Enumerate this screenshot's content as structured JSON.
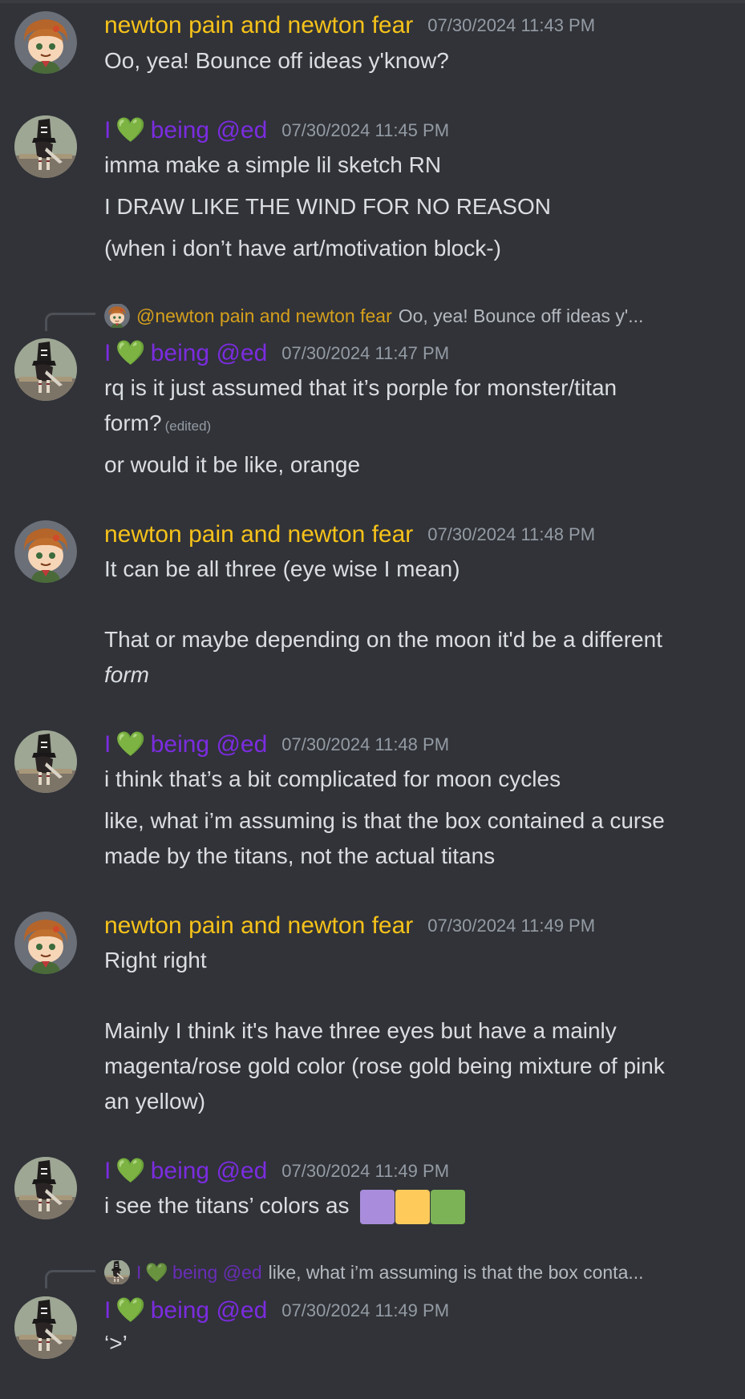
{
  "colors": {
    "newton_name": "#f6c21a",
    "ed_name": "#7b2ce0",
    "swatches": [
      "#a98ddc",
      "#fecb5b",
      "#7cb356"
    ]
  },
  "users": {
    "newton": {
      "name": "newton pain and newton fear",
      "avatar": "chibi-character-avatar"
    },
    "ed": {
      "name_prefix": "I",
      "name_emoji": "💚",
      "name_suffix": "being @ed",
      "avatar": "plague-doctor-avatar"
    }
  },
  "messages": [
    {
      "user": "newton",
      "timestamp": "07/30/2024 11:43 PM",
      "lines": [
        "Oo, yea! Bounce off ideas y'know?"
      ]
    },
    {
      "user": "ed",
      "timestamp": "07/30/2024 11:45 PM",
      "lines": [
        "imma make a simple lil sketch RN",
        "I DRAW LIKE THE WIND FOR NO REASON",
        "(when i don’t have art/motivation block-)"
      ]
    },
    {
      "user": "ed",
      "timestamp": "07/30/2024 11:47 PM",
      "reply": {
        "name": "@newton pain and newton fear",
        "text": "Oo, yea! Bounce off ideas y'..."
      },
      "lines": [
        "rq is it just assumed that it’s porple for monster/titan",
        "form?",
        "or would it be like, orange"
      ],
      "edited": "(edited)"
    },
    {
      "user": "newton",
      "timestamp": "07/30/2024 11:48 PM",
      "lines": [
        "It can be all three (eye wise I mean)",
        "That or maybe depending on the moon it'd be a different",
        "form"
      ]
    },
    {
      "user": "ed",
      "timestamp": "07/30/2024 11:48 PM",
      "lines": [
        "i think that’s a bit complicated for moon cycles",
        "like, what i’m assuming is that the box contained a curse",
        "made by the titans, not the actual titans"
      ]
    },
    {
      "user": "newton",
      "timestamp": "07/30/2024 11:49 PM",
      "lines": [
        "Right right",
        "Mainly I think it's have three eyes but have a mainly",
        "magenta/rose gold color (rose gold being mixture of pink",
        "an yellow)"
      ]
    },
    {
      "user": "ed",
      "timestamp": "07/30/2024 11:49 PM",
      "lines": [
        "i see the titans’ colors as"
      ]
    },
    {
      "user": "ed",
      "timestamp": "07/30/2024 11:49 PM",
      "reply": {
        "name_prefix": "I",
        "name_emoji": "💚",
        "name_suffix": "being @ed",
        "text": "like, what i’m assuming is that the box conta..."
      },
      "lines": [
        "‘>’"
      ]
    }
  ]
}
